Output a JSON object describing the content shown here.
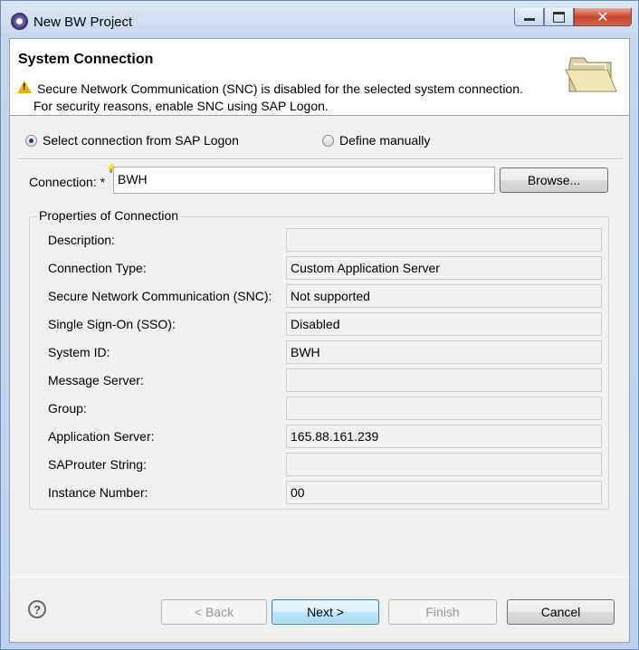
{
  "window": {
    "title": "New BW Project"
  },
  "header": {
    "title": "System Connection",
    "warning_line1": "Secure Network Communication (SNC) is disabled for the selected system connection.",
    "warning_line2": "For security reasons, enable SNC using SAP Logon."
  },
  "mode": {
    "sap_logon_label": "Select connection from SAP Logon",
    "manual_label": "Define manually",
    "selected": "sap_logon"
  },
  "connection": {
    "label": "Connection: *",
    "value": "BWH",
    "browse_label": "Browse..."
  },
  "properties": {
    "legend": "Properties of Connection",
    "rows": [
      {
        "label": "Description:",
        "value": ""
      },
      {
        "label": "Connection Type:",
        "value": "Custom Application Server"
      },
      {
        "label": "Secure Network Communication (SNC):",
        "value": "Not supported"
      },
      {
        "label": "Single Sign-On (SSO):",
        "value": "Disabled"
      },
      {
        "label": "System ID:",
        "value": "BWH"
      },
      {
        "label": "Message Server:",
        "value": ""
      },
      {
        "label": "Group:",
        "value": ""
      },
      {
        "label": "Application Server:",
        "value": "165.88.161.239"
      },
      {
        "label": "SAProuter String:",
        "value": ""
      },
      {
        "label": "Instance Number:",
        "value": "00"
      }
    ]
  },
  "footer": {
    "help_glyph": "?",
    "back_label": "< Back",
    "next_label": "Next >",
    "finish_label": "Finish",
    "cancel_label": "Cancel"
  }
}
